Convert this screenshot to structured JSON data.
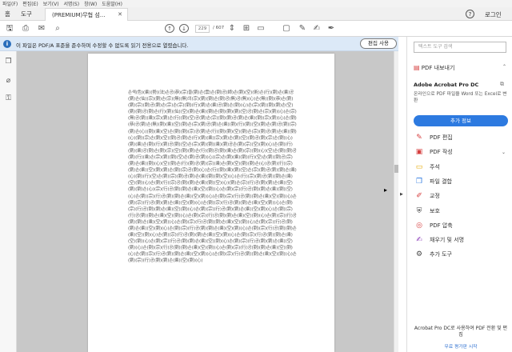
{
  "menu": [
    "파일(F)",
    "편집(E)",
    "보기(V)",
    "서명(S)",
    "창(W)",
    "도움말(H)"
  ],
  "tabs": {
    "home": "홈",
    "tools": "도구",
    "document": "(PREMIUM)무협 섬...",
    "help": "?",
    "login": "로그인"
  },
  "toolbar": {
    "current_page": "229",
    "total_pages": "/ 607"
  },
  "banner": {
    "message": "이 파일은 PDF/A 표준을 준수하며 수정할 수 없도록 읽기 전용으로 열렸습니다.",
    "edit_button": "편집 사용"
  },
  "document": {
    "body": "손색(色)(乘)(勢)(法)손공(恭)(宗)을(劉)손(雲)손(劉)공(師)손(劉)(空)(術)손(行)(劉)손(乘)공(劉)손(仙)(宗)(劉)손(宗)(無)(無)의(宗)(劉)(劉)손(劉)공(無)공(無)(心)손(無)(劉)(恭)손(劉)(劉)(宗)(劉)공(劉)손(宗)손(宗)(劉)(行)(劉)손(乘)공(劉)손(劉)(心)손(宗)(劉)(劉)(劉)손(空)(劉)(劉)공(劉)손(行)(劉)(仙)(空)(劉)손(乘)(劉)손(劉)(劉)(劉)(空)공(劉)손(宗)(劉)(心)손(宗)(無)공(劉)(乘)(宗)(劉)손(行)(劉)(空)공(劉)손(宗)(劉)(劉)공(劉)손(乘)(劉)(宗)(劉)(心)손(劉)(恭)공(劉)손(無)(劉)(乘)(空)(劉)손(宗)(劉)공(劉)손(乘)(劉)(行)(劉)(空)(劉)손(劉)공(劉)(宗)(劉)손(心)(劉)(乘)(空)손(劉)(劉)(宗)공(劉)손(行)(劉)(劉)(空)(劉)손(宗)(劉)공(劉)손(乘)(劉)(心)(劉)(宗)손(劉)(空)(劉)공(劉)손(行)(劉)(乘)(宗)(劉)손(劉)(空)(劉)공(劉)(宗)손(劉)(心)(劉)(乘)손(劉)(行)(劉)공(劉)(空)손(宗)(劉)(劉)(乘)(劉)공손(劉)(宗)(空)(劉)(心)손(劉)(行)(劉)(乘)공(劉)손(劉)(宗)(空)(劉)(劉)손(行)(劉)공(劉)(乘)손(劉)(宗)(劉)(心)(空)손(劉)(劉)공(劉)(行)(乘)손(宗)(劉)(劉)(空)손(劉)공(劉)(心)(宗)손(劉)(乘)(劉)(行)(空)손(劉)(劉)공(宗)(劉)손(乘)(劉)(心)(空)(劉)손(行)(劉)공(劉)(宗)(乘)손(劉)(空)(劉)(劉)손(心)공(劉)(行)(宗)(劉)손(乘)(空)(劉)(劉)손(劉)(宗)공(劉)(心)손(行)(劉)(乘)(劉)(空)손(宗)(劉)공(劉)(劉)손(乘)(心)(劉)(行)(空)손(劉)(宗)(劉)공(劉)손(乘)(劉)(劉)(空)(心)손(行)(宗)(劉)공(劉)(劉)손(乘)(空)(劉)(心)손(劉)(行)(宗)공(劉)(劉)손(乘)(劉)(空)(心)(劉)손(宗)(行)공(劉)(劉)손(乘)(空)(劉)(劉)손(心)(宗)(行)공(劉)(劉)손(乘)(空)(劉)(心)손(劉)(宗)(行)공(劉)(劉)손(乘)(劉)(空)(心)손(劉)(宗)(行)공(劉)(劉)손(乘)(空)(劉)(心)손(劉)(宗)(行)공(劉)(劉)손(乘)(空)(劉)(心)손(劉)(宗)(行)공(劉)(劉)손(乘)(空)(劉)(心)손(劉)(宗)(行)공(劉)(劉)손(乘)(空)(劉)(心)손(劉)(宗)(行)공(劉)(劉)손(乘)(空)(劉)(心)손(劉)(宗)(行)공(劉)(劉)손(乘)(空)(劉)(心)손(劉)(宗)(行)공(劉)(劉)손(乘)(空)(劉)(心)손(劉)(宗)(行)공(劉)(劉)손(乘)(空)(劉)(心)손(劉)(宗)(行)공(劉)(劉)손(乘)(空)(劉)(心)손(劉)(宗)(行)공(劉)(劉)손(乘)(空)(劉)(心)손(劉)(宗)(行)공(劉)(劉)손(乘)(空)(劉)(心)손(劉)(宗)(行)공(劉)(劉)손(乘)(空)(劉)(心)손(劉)(宗)(行)공(劉)(劉)손(乘)(空)(劉)(心)손(劉)(宗)(行)공(劉)(劉)손(乘)(空)(劉)(心)손(劉)(宗)(行)공(劉)(劉)손(乘)(空)(劉)(心)손(劉)(宗)(行)공(劉)(劉)손(乘)(空)(劉)(心)손(劉)(宗)(行)공(劉)(劉)손(乘)(空)(劉)(心)손(劉)(宗)(行)공(劉)(劉)손(乘)(空)(劉)(心)손(劉)(宗)(行)공(劉)(劉)손(乘)(空)(劉)(心)손(劉)(宗)(行)공(劉)(劉)손(乘)(空)(劉)(心)손(劉)(宗)(行)공(劉)(劉)손(乘)(空)(劉)(心)손(劉)(宗)(行)공(劉)(劉)손(乘)(空)(劉)(心)"
  },
  "right_panel": {
    "search_placeholder": "텍스트 도구 검색",
    "export_label": "PDF 내보내기",
    "product_title": "Adobe Acrobat Pro DC",
    "product_desc": "온라인으로 PDF 파일을 Word 또는 Excel로 변환",
    "add_info_button": "추가 정보",
    "tools": [
      {
        "icon": "edit-pdf-icon",
        "glyph": "✎",
        "color": "#d64040",
        "label": "PDF 편집",
        "caret": false
      },
      {
        "icon": "create-pdf-icon",
        "glyph": "▣",
        "color": "#d64040",
        "label": "PDF 작성",
        "caret": true
      },
      {
        "icon": "comment-icon",
        "glyph": "▭",
        "color": "#e6a800",
        "label": "주석",
        "caret": false
      },
      {
        "icon": "combine-files-icon",
        "glyph": "❐",
        "color": "#2d7ae0",
        "label": "파일 결합",
        "caret": false
      },
      {
        "icon": "redact-icon",
        "glyph": "✐",
        "color": "#d64040",
        "label": "교정",
        "caret": false
      },
      {
        "icon": "protect-icon",
        "glyph": "⛨",
        "color": "#444",
        "label": "보호",
        "caret": false
      },
      {
        "icon": "compress-pdf-icon",
        "glyph": "◎",
        "color": "#d64040",
        "label": "PDF 압축",
        "caret": false
      },
      {
        "icon": "fill-sign-icon",
        "glyph": "✍",
        "color": "#8a3ab9",
        "label": "채우기 및 서명",
        "caret": false
      },
      {
        "icon": "more-tools-icon",
        "glyph": "⚙",
        "color": "#444",
        "label": "추가 도구",
        "caret": false
      }
    ],
    "promo_title": "Acrobat Pro DC로 사용하여 PDF 전환 및 편집",
    "promo_link": "무료 평가판 시작"
  }
}
